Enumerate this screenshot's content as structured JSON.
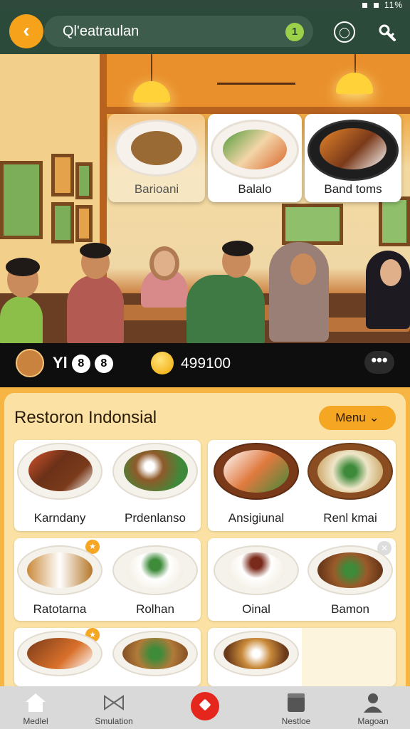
{
  "status_bar": {
    "indicator": "11%"
  },
  "header": {
    "title": "Ql'eatraulan",
    "badge": "1",
    "icon_left": "back-arrow-icon",
    "icon_a": "circle-menu-icon",
    "icon_b": "share-icon"
  },
  "hero": {
    "dishes": [
      {
        "label": "Barioani"
      },
      {
        "label": "Balalo"
      },
      {
        "label": "Band toms"
      }
    ]
  },
  "info": {
    "code": "Yl",
    "circle_a": "8",
    "circle_b": "8",
    "coins": "499100",
    "more": "•••"
  },
  "section": {
    "title": "Restoron Indonsial",
    "menu_label": "Menu"
  },
  "cards": [
    {
      "items": [
        {
          "name": "Karndany"
        },
        {
          "name": "Prdenlanso"
        }
      ]
    },
    {
      "items": [
        {
          "name": "Ansigiunal"
        },
        {
          "name": "Renl kmai"
        }
      ]
    },
    {
      "items": [
        {
          "name": "Ratotarna"
        },
        {
          "name": "Rolhan"
        }
      ]
    },
    {
      "items": [
        {
          "name": "Oinal"
        },
        {
          "name": "Bamon"
        }
      ]
    },
    {
      "items": [
        {
          "name": ""
        },
        {
          "name": ""
        }
      ]
    },
    {
      "items": [
        {
          "name": ""
        }
      ]
    }
  ],
  "nav": [
    {
      "label": "Medlel",
      "icon": "home-icon"
    },
    {
      "label": "Smulation",
      "icon": "bowtie-icon"
    },
    {
      "label": "",
      "icon": "center-action-icon"
    },
    {
      "label": "Nestloe",
      "icon": "box-icon"
    },
    {
      "label": "Magoan",
      "icon": "person-icon"
    }
  ],
  "colors": {
    "accent": "#f5a623",
    "header": "#2c4a3a",
    "panel": "#f6b442",
    "nav_action": "#e4261d"
  }
}
